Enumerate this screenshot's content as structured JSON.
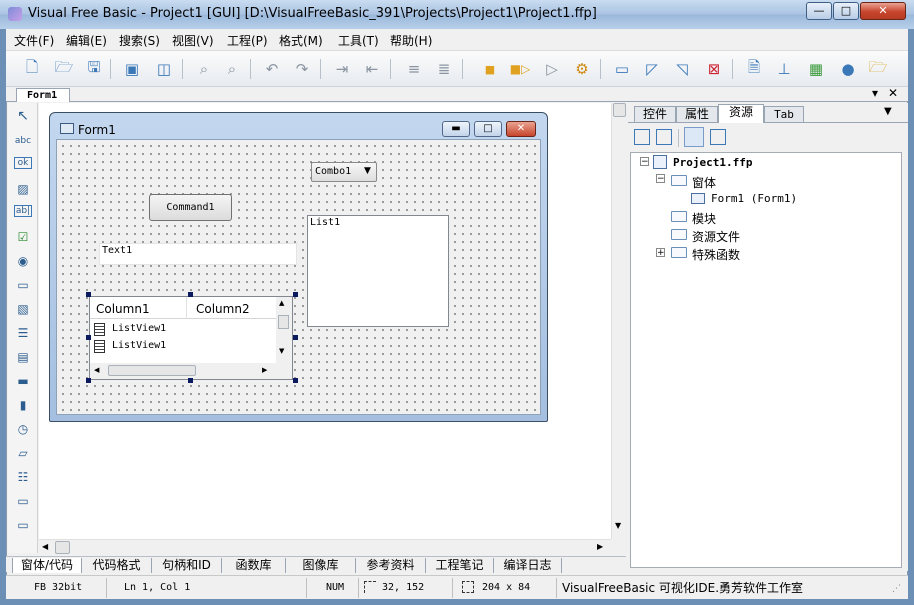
{
  "window": {
    "title": "Visual Free Basic - Project1 [GUI]  [D:\\VisualFreeBasic_391\\Projects\\Project1\\Project1.ffp]",
    "min_label": "—",
    "max_label": "□",
    "close_label": "✕"
  },
  "menu": [
    "文件(F)",
    "编辑(E)",
    "搜索(S)",
    "视图(V)",
    "工程(P)",
    "格式(M)",
    "工具(T)",
    "帮助(H)"
  ],
  "doc_tab": "Form1",
  "doc_tab_controls": {
    "dropdown": "▾",
    "close": "✕"
  },
  "form": {
    "title": "Form1",
    "combo": "Combo1",
    "command": "Command1",
    "text": "Text1",
    "list": "List1",
    "listview": {
      "columns": [
        "Column1",
        "Column2"
      ],
      "items": [
        "ListView1",
        "ListView1"
      ]
    }
  },
  "right_panel": {
    "tabs": [
      "控件",
      "属性",
      "资源",
      "Tab"
    ],
    "tree": {
      "root": "Project1.ffp",
      "forms_folder": "窗体",
      "form_item": "Form1 (Form1)",
      "modules": "模块",
      "resources": "资源文件",
      "special": "特殊函数"
    }
  },
  "bottom_tabs": [
    "窗体/代码",
    "代码格式",
    "句柄和ID",
    "函数库",
    "图像库",
    "参考资料",
    "工程笔记",
    "编译日志"
  ],
  "status": {
    "arch": "FB 32bit",
    "position": "Ln 1,  Col 1",
    "num": "NUM",
    "coords": "32, 152",
    "size": "204 x 84",
    "credit": "VisualFreeBasic 可视化IDE.勇芳软件工作室"
  }
}
